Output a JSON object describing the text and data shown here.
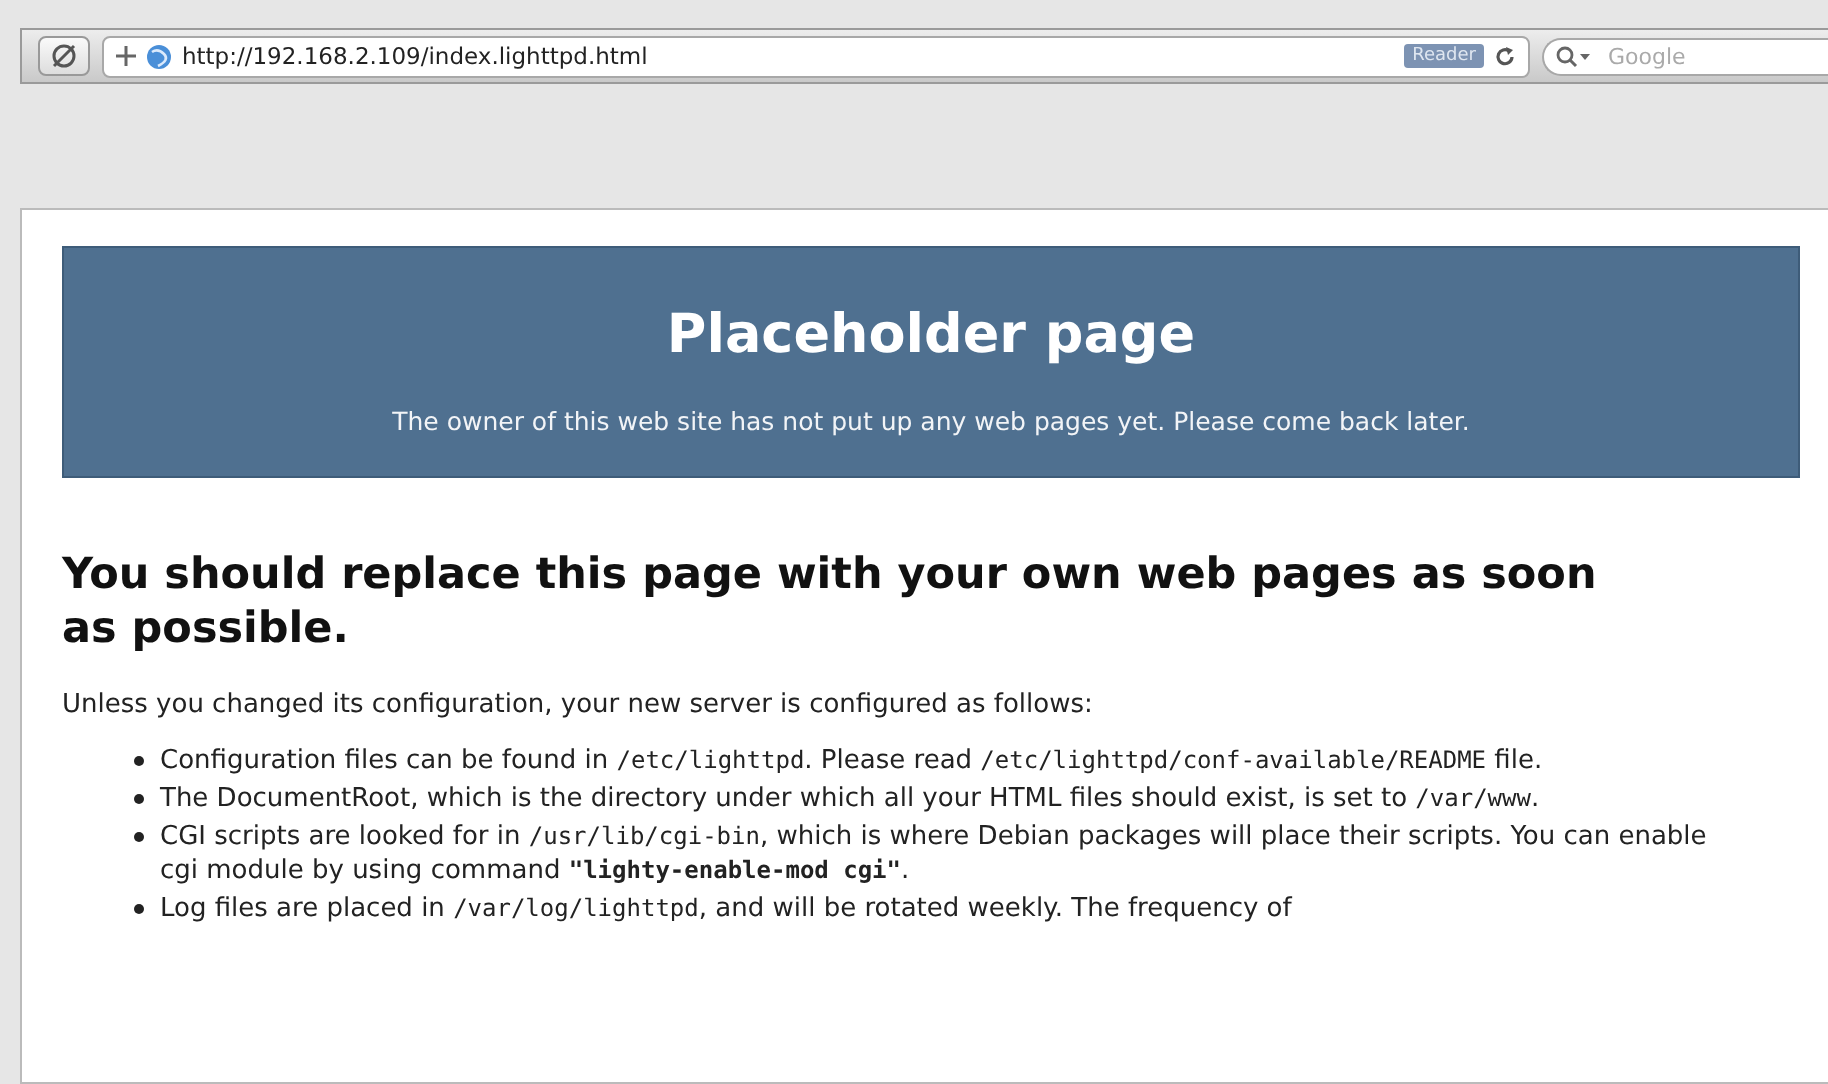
{
  "toolbar": {
    "url": "http://192.168.2.109/index.lighttpd.html",
    "reader_label": "Reader",
    "search": {
      "placeholder": "Google"
    }
  },
  "banner": {
    "title": "Placeholder page",
    "subtitle": "The owner of this web site has not put up any web pages yet. Please come back later."
  },
  "heading": "You should replace this page with your own web pages as soon as possible.",
  "intro": "Unless you changed its configuration, your new server is configured as follows:",
  "items": [
    [
      {
        "kind": "text",
        "text": "Configuration files can be found in "
      },
      {
        "kind": "code",
        "text": "/etc/lighttpd"
      },
      {
        "kind": "text",
        "text": ". Please read "
      },
      {
        "kind": "code",
        "text": "/etc/lighttpd/conf-available/README"
      },
      {
        "kind": "text",
        "text": " file."
      }
    ],
    [
      {
        "kind": "text",
        "text": "The DocumentRoot, which is the directory under which all your HTML files should exist, is set to "
      },
      {
        "kind": "code",
        "text": "/var/www"
      },
      {
        "kind": "text",
        "text": "."
      }
    ],
    [
      {
        "kind": "text",
        "text": "CGI scripts are looked for in "
      },
      {
        "kind": "code",
        "text": "/usr/lib/cgi-bin"
      },
      {
        "kind": "text",
        "text": ", which is where Debian packages will place their scripts. You can enable cgi module by using command "
      },
      {
        "kind": "command",
        "text": "\"lighty-enable-mod cgi\""
      },
      {
        "kind": "text",
        "text": "."
      }
    ],
    [
      {
        "kind": "text",
        "text": "Log files are placed in "
      },
      {
        "kind": "code",
        "text": "/var/log/lighttpd"
      },
      {
        "kind": "text",
        "text": ", and will be rotated weekly. The frequency of"
      }
    ]
  ]
}
